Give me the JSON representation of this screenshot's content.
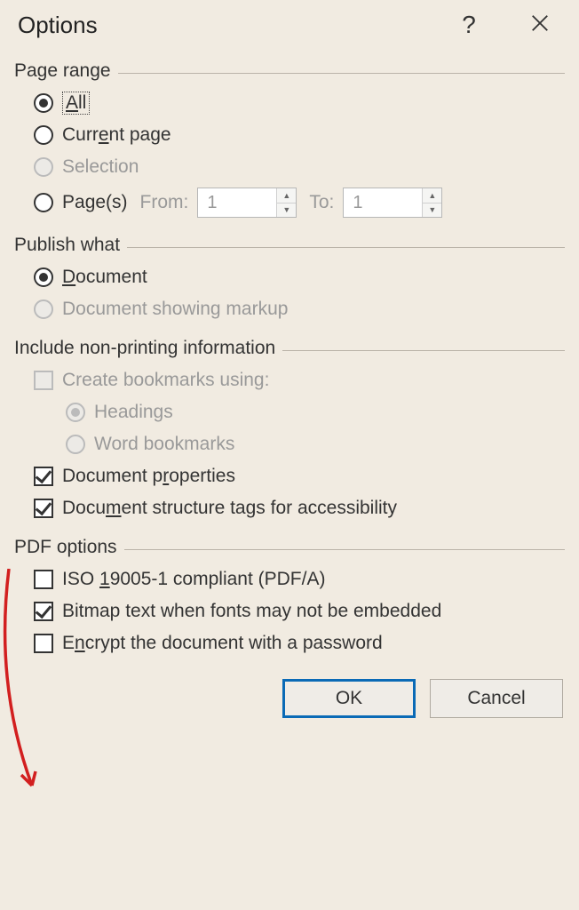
{
  "dialog": {
    "title": "Options"
  },
  "pageRange": {
    "groupLabel": "Page range",
    "all": "All",
    "currentPage": "Current page",
    "selection": "Selection",
    "pages": "Page(s)",
    "fromLabel": "From:",
    "toLabel": "To:",
    "fromValue": "1",
    "toValue": "1"
  },
  "publishWhat": {
    "groupLabel": "Publish what",
    "document": "Document",
    "documentMarkup": "Document showing markup"
  },
  "includeNonPrinting": {
    "groupLabel": "Include non-printing information",
    "createBookmarks": "Create bookmarks using:",
    "headings": "Headings",
    "wordBookmarks": "Word bookmarks",
    "docProperties": "Document properties",
    "docStructureTags": "Document structure tags for accessibility"
  },
  "pdfOptions": {
    "groupLabel": "PDF options",
    "iso": "ISO 19005-1 compliant (PDF/A)",
    "bitmapText": "Bitmap text when fonts may not be embedded",
    "encrypt": "Encrypt the document with a password"
  },
  "buttons": {
    "ok": "OK",
    "cancel": "Cancel"
  }
}
